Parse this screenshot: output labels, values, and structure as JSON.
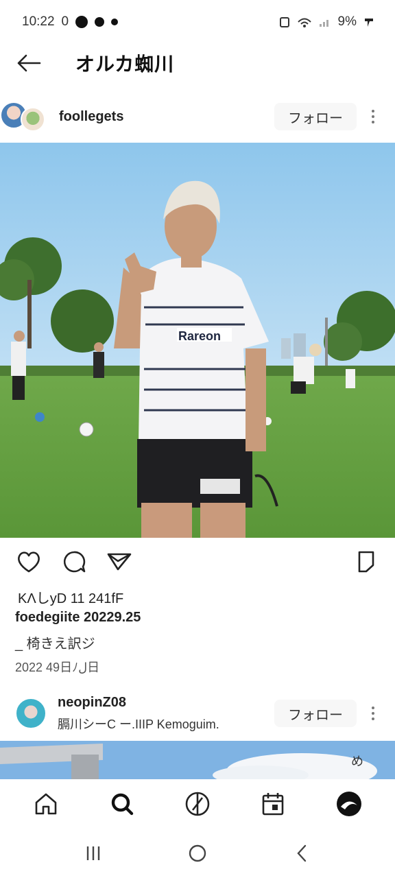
{
  "status_bar": {
    "time": "10:22",
    "extra": "0",
    "battery": "9%"
  },
  "header": {
    "title": "オルカ蜘川"
  },
  "post1": {
    "username": "foollegets",
    "follow_label": "フォロー",
    "likes": "KΛしyD 11 241fF",
    "caption": "foedegiite 20229.25",
    "subcaption": "_ 椅きえ訳ジ",
    "date": "2022 49日ﾉل日"
  },
  "post2": {
    "username": "neopinZ08",
    "subline": "膈川シーC ー.IIIP Kemoguim.",
    "follow_label": "フォロー",
    "corner_label": "め"
  },
  "icons": {
    "back": "back-arrow-icon",
    "like": "heart-icon",
    "comment": "comment-bubble-icon",
    "share": "send-icon",
    "save": "bookmark-icon",
    "home": "home-icon",
    "search": "search-icon",
    "reels": "compass-icon",
    "shop": "calendar-icon",
    "profile": "profile-icon"
  }
}
